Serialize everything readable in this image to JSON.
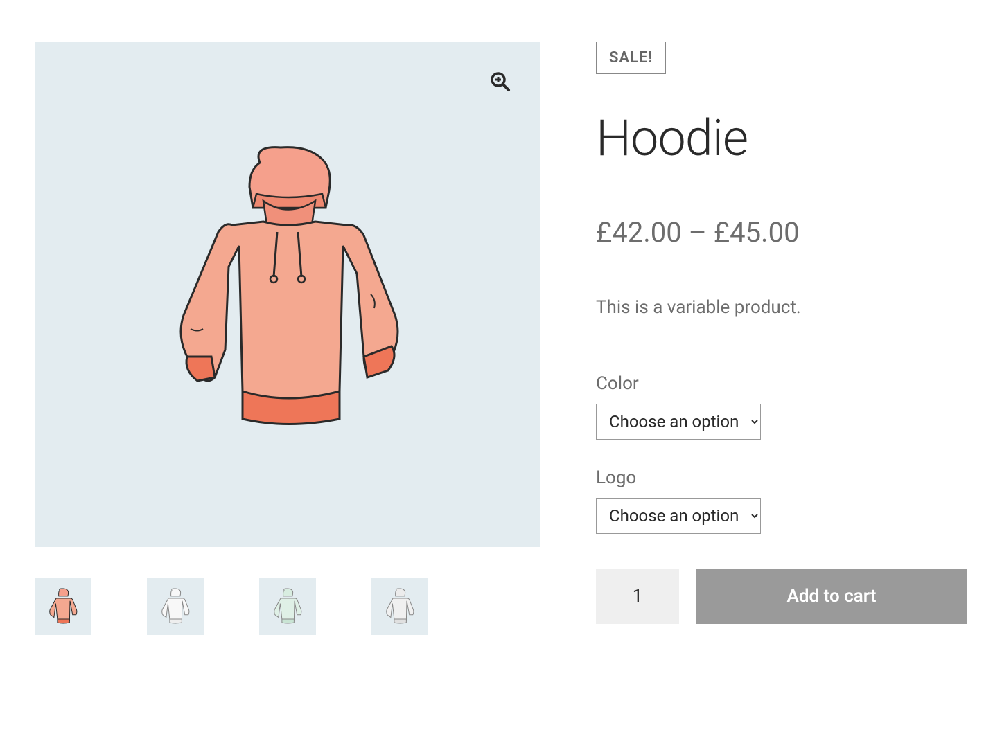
{
  "badge": "SALE!",
  "title": "Hoodie",
  "price_range": "£42.00 – £45.00",
  "description": "This is a variable product.",
  "variations": {
    "color": {
      "label": "Color",
      "placeholder": "Choose an option"
    },
    "logo": {
      "label": "Logo",
      "placeholder": "Choose an option"
    }
  },
  "quantity": "1",
  "add_to_cart_label": "Add to cart",
  "thumbnails": [
    {
      "color": "salmon"
    },
    {
      "color": "white"
    },
    {
      "color": "mint"
    },
    {
      "color": "grey"
    }
  ],
  "icons": {
    "zoom": "zoom-in-icon"
  }
}
